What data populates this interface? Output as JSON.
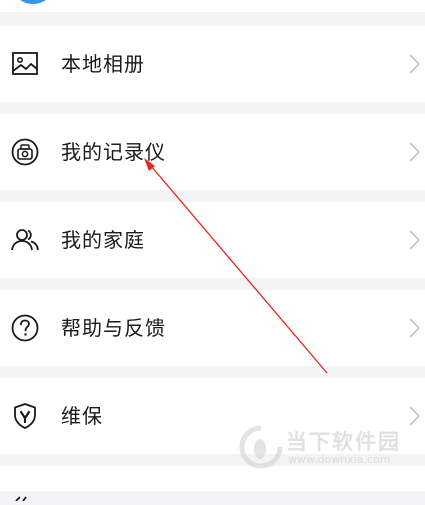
{
  "menu": {
    "items": [
      {
        "label": "本地相册",
        "icon": "image-icon"
      },
      {
        "label": "我的记录仪",
        "icon": "dashcam-icon"
      },
      {
        "label": "我的家庭",
        "icon": "family-icon"
      },
      {
        "label": "帮助与反馈",
        "icon": "help-icon"
      },
      {
        "label": "维保",
        "icon": "maintenance-shield-icon"
      }
    ]
  },
  "watermark": {
    "name": "当下软件园",
    "url": "www.downxia.com"
  },
  "colors": {
    "background": "#f3f3f5",
    "row": "#ffffff",
    "text": "#1a1a1a",
    "chevron": "#c4c4c4",
    "annotation": "#e8231b",
    "avatar": "#2f9be8"
  }
}
